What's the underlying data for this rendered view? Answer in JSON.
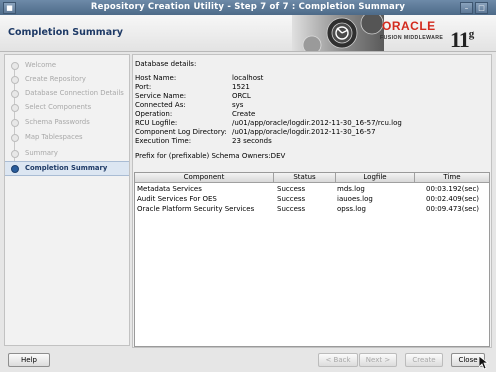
{
  "window": {
    "title": "Repository Creation Utility - Step 7 of 7 : Completion Summary"
  },
  "header": {
    "page_title": "Completion Summary",
    "brand": "ORACLE",
    "brand_sub": "FUSION MIDDLEWARE",
    "version": "11",
    "version_sup": "g"
  },
  "nav": {
    "items": [
      {
        "label": "Welcome",
        "active": false
      },
      {
        "label": "Create Repository",
        "active": false
      },
      {
        "label": "Database Connection Details",
        "active": false
      },
      {
        "label": "Select Components",
        "active": false
      },
      {
        "label": "Schema Passwords",
        "active": false
      },
      {
        "label": "Map Tablespaces",
        "active": false
      },
      {
        "label": "Summary",
        "active": false
      },
      {
        "label": "Completion Summary",
        "active": true
      }
    ]
  },
  "details": {
    "title": "Database details:",
    "rows": [
      {
        "key": "Host Name:",
        "value": "localhost"
      },
      {
        "key": "Port:",
        "value": "1521"
      },
      {
        "key": "Service Name:",
        "value": "ORCL"
      },
      {
        "key": "Connected As:",
        "value": "sys"
      },
      {
        "key": "Operation:",
        "value": "Create"
      },
      {
        "key": "RCU Logfile:",
        "value": "/u01/app/oracle/logdir.2012-11-30_16-57/rcu.log"
      },
      {
        "key": "Component Log Directory:",
        "value": "/u01/app/oracle/logdir.2012-11-30_16-57"
      },
      {
        "key": "Execution Time:",
        "value": "23  seconds"
      }
    ],
    "prefix_line": "Prefix for (prefixable) Schema Owners:DEV"
  },
  "table": {
    "columns": [
      "Component",
      "Status",
      "Logfile",
      "Time"
    ],
    "rows": [
      {
        "component": "Metadata Services",
        "status": "Success",
        "logfile": "mds.log",
        "time": "00:03.192(sec)"
      },
      {
        "component": "Audit Services For OES",
        "status": "Success",
        "logfile": "iauoes.log",
        "time": "00:02.409(sec)"
      },
      {
        "component": "Oracle Platform Security Services",
        "status": "Success",
        "logfile": "opss.log",
        "time": "00:09.473(sec)"
      }
    ]
  },
  "buttons": {
    "help": "Help",
    "back": "< Back",
    "next": "Next >",
    "create": "Create",
    "close": "Close"
  }
}
